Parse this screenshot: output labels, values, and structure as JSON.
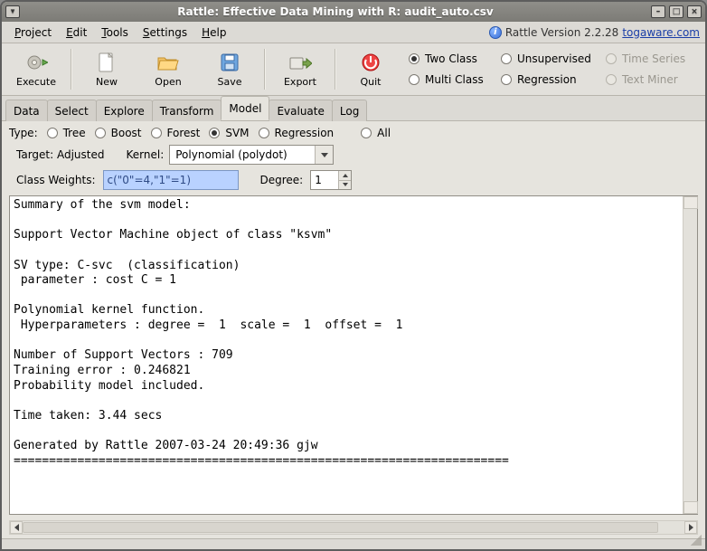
{
  "title": "Rattle: Effective Data Mining with R: audit_auto.csv",
  "menubar": {
    "project": "Project",
    "edit": "Edit",
    "tools": "Tools",
    "settings": "Settings",
    "help": "Help",
    "version_prefix": "Rattle Version 2.2.28 ",
    "version_link": "togaware.com"
  },
  "toolbar": {
    "execute": "Execute",
    "new": "New",
    "open": "Open",
    "save": "Save",
    "export": "Export",
    "quit": "Quit",
    "radios": {
      "two_class": "Two Class",
      "multi_class": "Multi Class",
      "unsupervised": "Unsupervised",
      "regression": "Regression",
      "time_series": "Time Series",
      "text_miner": "Text Miner"
    }
  },
  "tabs": {
    "data": "Data",
    "select": "Select",
    "explore": "Explore",
    "transform": "Transform",
    "model": "Model",
    "evaluate": "Evaluate",
    "log": "Log"
  },
  "typerow": {
    "label": "Type:",
    "tree": "Tree",
    "boost": "Boost",
    "forest": "Forest",
    "svm": "SVM",
    "regression": "Regression",
    "all": "All"
  },
  "paramrow": {
    "target": "Target: Adjusted",
    "kernel_label": "Kernel:",
    "kernel_value": "Polynomial (polydot)"
  },
  "optrow": {
    "cw_label": "Class Weights:",
    "cw_value": "c(\"0\"=4,\"1\"=1)",
    "degree_label": "Degree:",
    "degree_value": "1"
  },
  "output_text": "Summary of the svm model:\n\nSupport Vector Machine object of class \"ksvm\"\n\nSV type: C-svc  (classification)\n parameter : cost C = 1\n\nPolynomial kernel function.\n Hyperparameters : degree =  1  scale =  1  offset =  1\n\nNumber of Support Vectors : 709\nTraining error : 0.246821\nProbability model included.\n\nTime taken: 3.44 secs\n\nGenerated by Rattle 2007-03-24 20:49:36 gjw\n======================================================================"
}
